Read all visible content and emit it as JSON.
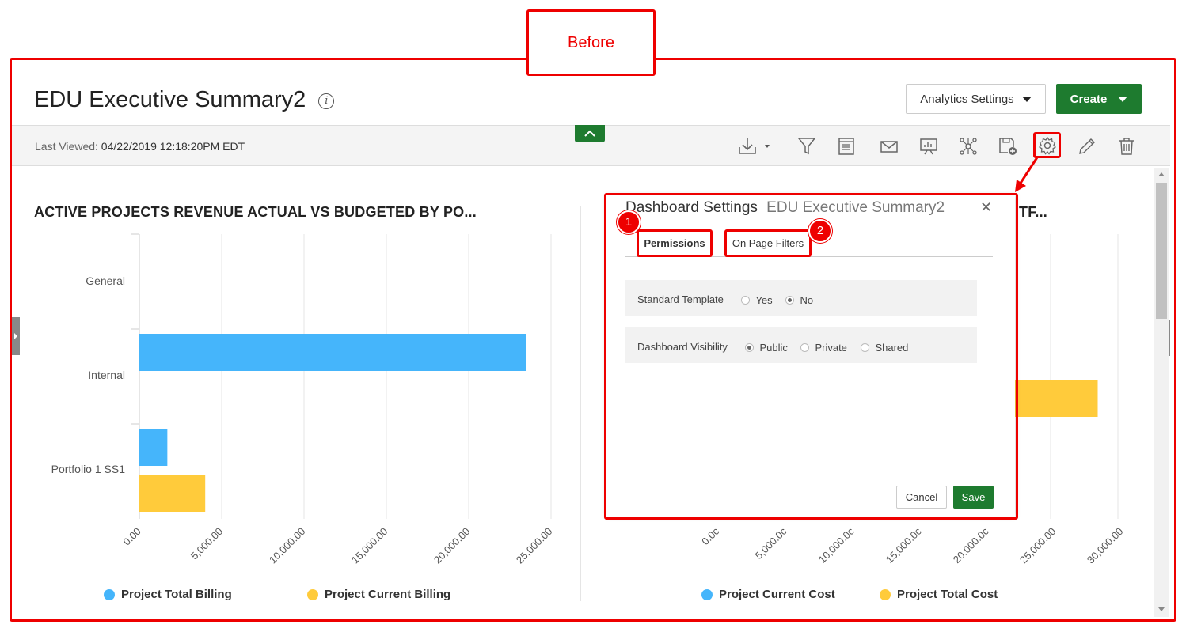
{
  "callout": {
    "label": "Before"
  },
  "header": {
    "title": "EDU Executive Summary2",
    "analytics_settings_label": "Analytics Settings",
    "create_label": "Create"
  },
  "toolbar": {
    "last_viewed_label": "Last Viewed:",
    "last_viewed_value": "04/22/2019 12:18:20PM EDT"
  },
  "left_chart": {
    "title": "ACTIVE PROJECTS REVENUE ACTUAL VS BUDGETED BY PO...",
    "categories": [
      "General",
      "Internal",
      "Portfolio 1 SS1"
    ],
    "x_ticks": [
      "0.00",
      "5,000.00",
      "10,000.00",
      "15,000.00",
      "20,000.00",
      "25,000.00"
    ],
    "legend": [
      "Project Total Billing",
      "Project Current Billing"
    ]
  },
  "right_chart": {
    "title_fragment": "TF...",
    "x_ticks": [
      "0.0c",
      "5,000.0c",
      "10,000.0c",
      "15,000.0c",
      "20,000.0c",
      "25,000.00",
      "30,000.00"
    ],
    "legend": [
      "Project Current Cost",
      "Project Total Cost"
    ]
  },
  "dialog": {
    "title": "Dashboard Settings",
    "subtitle": "EDU Executive Summary2",
    "close_glyph": "✕",
    "tabs": [
      "Permissions",
      "On Page Filters"
    ],
    "badges": [
      "1",
      "2"
    ],
    "standard_template": {
      "label": "Standard Template",
      "options": [
        "Yes",
        "No"
      ],
      "selected": "No"
    },
    "visibility": {
      "label": "Dashboard Visibility",
      "options": [
        "Public",
        "Private",
        "Shared"
      ],
      "selected": "Public"
    },
    "cancel_label": "Cancel",
    "save_label": "Save"
  },
  "chart_data": [
    {
      "type": "bar",
      "title": "ACTIVE PROJECTS REVENUE ACTUAL VS BUDGETED BY PO...",
      "categories": [
        "General",
        "Internal",
        "Portfolio 1 SS1"
      ],
      "series": [
        {
          "name": "Project Total Billing",
          "values": [
            0,
            23500,
            1700
          ]
        },
        {
          "name": "Project Current Billing",
          "values": [
            0,
            0,
            4000
          ]
        }
      ],
      "xlim": [
        0,
        25000
      ],
      "orientation": "horizontal",
      "legend": "bottom"
    },
    {
      "type": "bar",
      "series": [
        {
          "name": "Project Current Cost",
          "values": []
        },
        {
          "name": "Project Total Cost",
          "values": [
            28500
          ]
        }
      ],
      "xlim": [
        0,
        30000
      ],
      "orientation": "horizontal",
      "legend": "bottom"
    }
  ],
  "colors": {
    "blue": "#45b5fb",
    "yellow": "#ffcb3b",
    "green": "#1e7b2f",
    "red": "#e00000"
  },
  "icons": [
    "download-icon",
    "filter-icon",
    "report-icon",
    "email-icon",
    "presentation-icon",
    "network-icon",
    "save-as-icon",
    "gear-icon",
    "pencil-icon",
    "trash-icon"
  ]
}
